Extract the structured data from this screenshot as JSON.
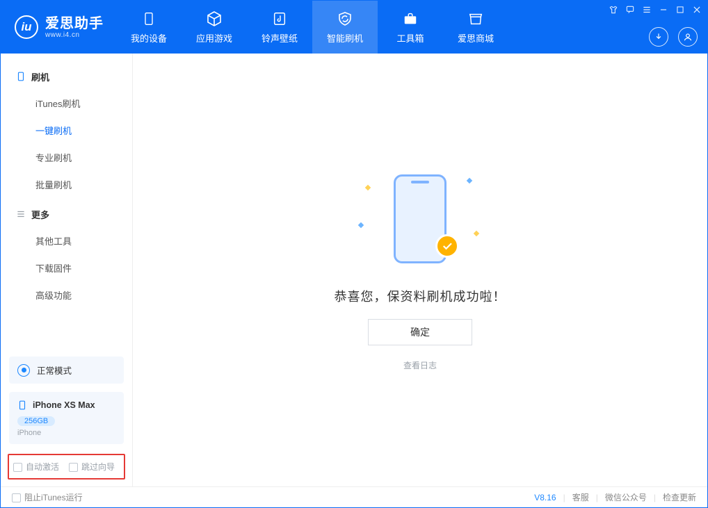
{
  "brand": {
    "title": "爱思助手",
    "subtitle": "www.i4.cn"
  },
  "tabs": {
    "device": {
      "label": "我的设备"
    },
    "apps": {
      "label": "应用游戏"
    },
    "ring": {
      "label": "铃声壁纸"
    },
    "flash": {
      "label": "智能刷机"
    },
    "toolbox": {
      "label": "工具箱"
    },
    "store": {
      "label": "爱思商城"
    }
  },
  "sidebar": {
    "group_flash": {
      "title": "刷机",
      "items": {
        "itunes": "iTunes刷机",
        "oneclick": "一键刷机",
        "pro": "专业刷机",
        "batch": "批量刷机"
      }
    },
    "group_more": {
      "title": "更多",
      "items": {
        "other": "其他工具",
        "firmware": "下载固件",
        "advanced": "高级功能"
      }
    }
  },
  "mode": {
    "label": "正常模式"
  },
  "device": {
    "name": "iPhone XS Max",
    "storage": "256GB",
    "type": "iPhone"
  },
  "options": {
    "auto_activate": "自动激活",
    "skip_guide": "跳过向导"
  },
  "main": {
    "success_text": "恭喜您，保资料刷机成功啦！",
    "ok_button": "确定",
    "view_log": "查看日志"
  },
  "footer": {
    "block_itunes": "阻止iTunes运行",
    "version": "V8.16",
    "cs": "客服",
    "wechat": "微信公众号",
    "update": "检查更新"
  }
}
